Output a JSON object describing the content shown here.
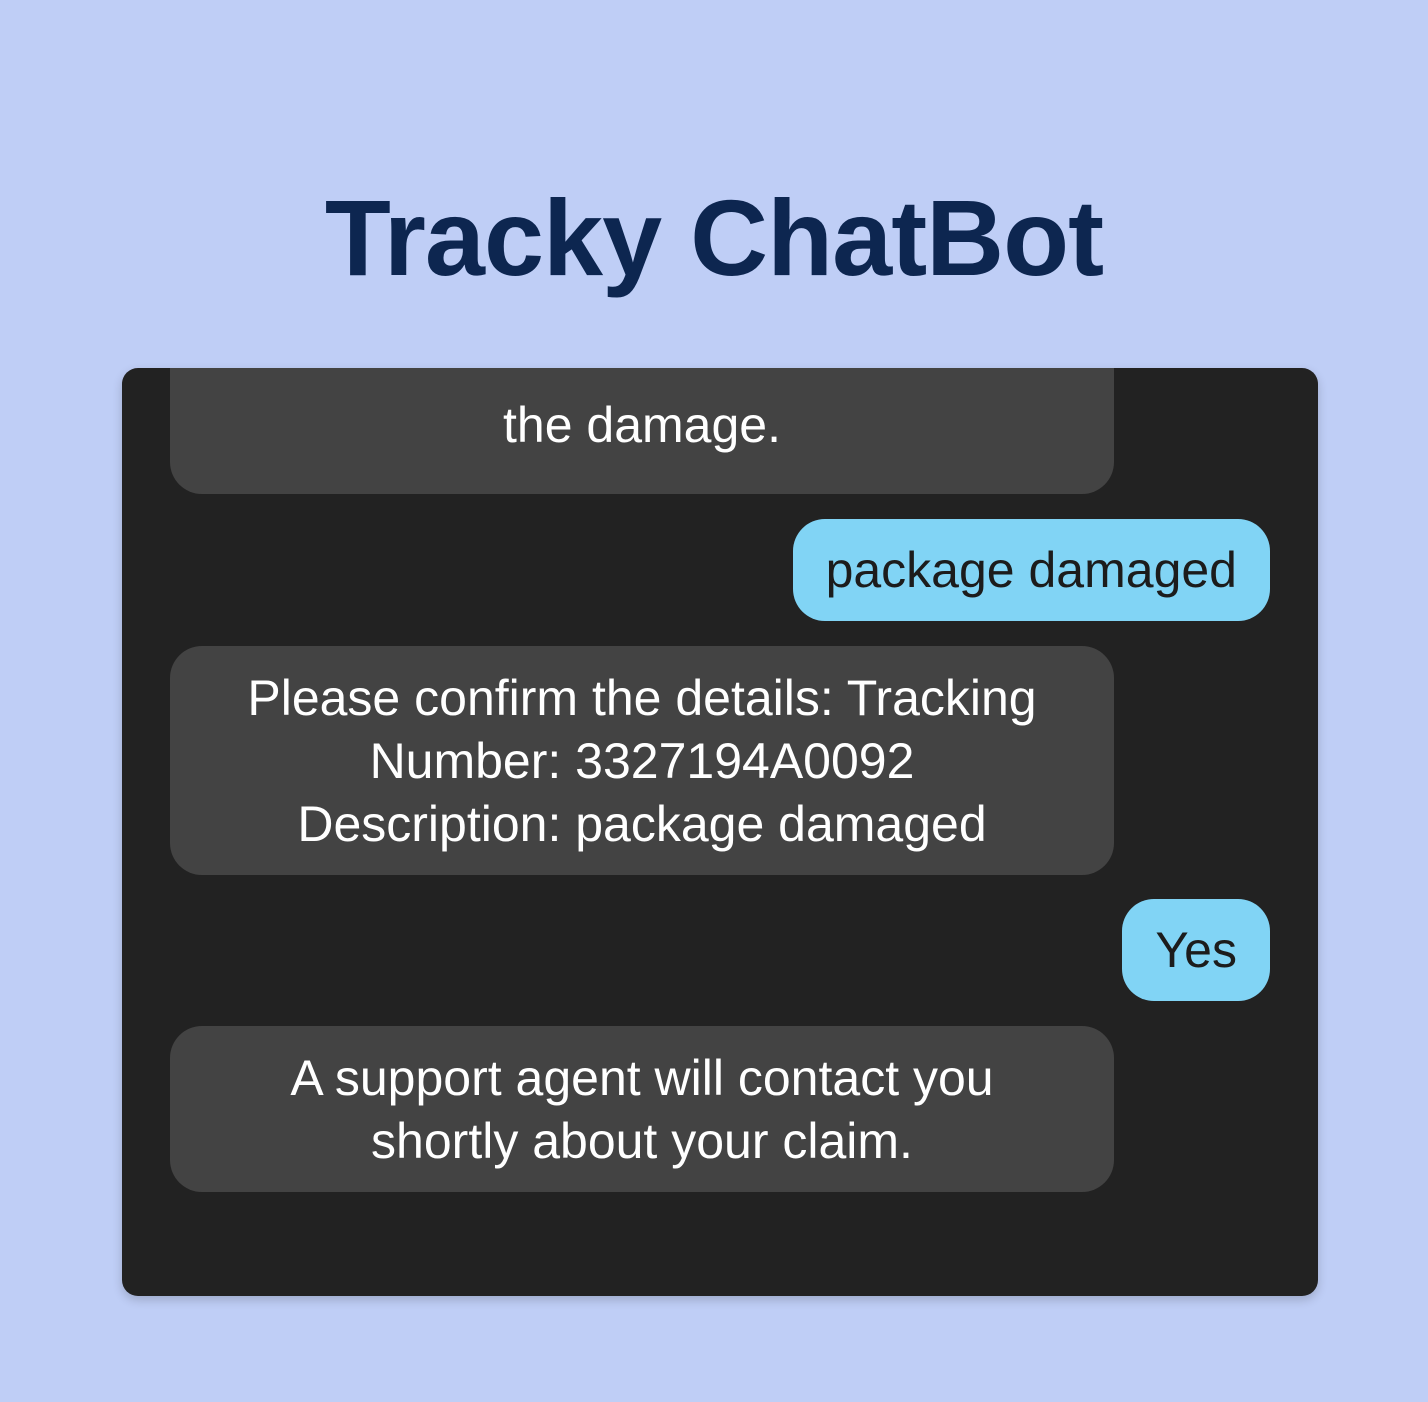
{
  "app": {
    "title": "Tracky ChatBot"
  },
  "messages": [
    {
      "sender": "bot",
      "text": "the damage."
    },
    {
      "sender": "user",
      "text": "package damaged"
    },
    {
      "sender": "bot",
      "text": "Please confirm the details: Tracking\nNumber: 3327194A0092\nDescription: package damaged"
    },
    {
      "sender": "user",
      "text": "Yes"
    },
    {
      "sender": "bot",
      "text": "A support agent will contact you\nshortly about your claim."
    }
  ],
  "colors": {
    "page_background": "#bfcef6",
    "title": "#0d2650",
    "chat_background": "#222222",
    "bot_bubble": "#434343",
    "user_bubble": "#81d4f5"
  }
}
